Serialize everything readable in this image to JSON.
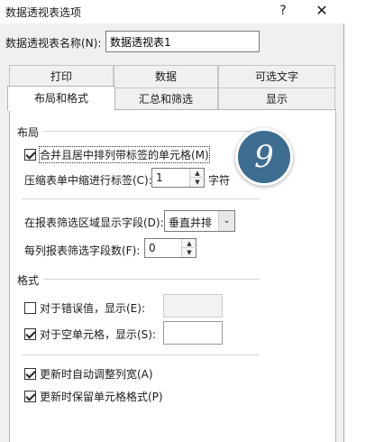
{
  "window": {
    "title": "数据透视表选项",
    "help_glyph": "?",
    "close_glyph": "✕"
  },
  "name_field": {
    "label": "数据透视表名称(N):",
    "value": "数据透视表1"
  },
  "tabs_row1": [
    {
      "label": "打印"
    },
    {
      "label": "数据"
    },
    {
      "label": "可选文字"
    }
  ],
  "tabs_row2": [
    {
      "label": "布局和格式",
      "active": true
    },
    {
      "label": "汇总和筛选"
    },
    {
      "label": "显示"
    }
  ],
  "layout_section": {
    "title": "布局",
    "merge_center": {
      "label": "合并且居中排列带标签的单元格(M)",
      "checked": true
    },
    "indent": {
      "label": "压缩表单中缩进行标签(C):",
      "value": "1",
      "unit": "字符"
    },
    "filter_area": {
      "label": "在报表筛选区域显示字段(D):",
      "value": "垂直并排"
    },
    "filter_count": {
      "label": "每列报表筛选字段数(F):",
      "value": "0"
    }
  },
  "format_section": {
    "title": "格式",
    "error_value": {
      "label": "对于错误值，显示(E):",
      "checked": false,
      "value": ""
    },
    "empty_cell": {
      "label": "对于空单元格，显示(S):",
      "checked": true,
      "value": ""
    },
    "autofit": {
      "label": "更新时自动调整列宽(A)",
      "checked": true
    },
    "preserve": {
      "label": "更新时保留单元格格式(P)",
      "checked": true
    }
  },
  "step_badge": "9",
  "colors": {
    "badge": "#3d6d90",
    "dialog_bg": "#f0f0f0"
  },
  "icons": {
    "spin_up": "▲",
    "spin_down": "▼",
    "dropdown": "⌄"
  }
}
